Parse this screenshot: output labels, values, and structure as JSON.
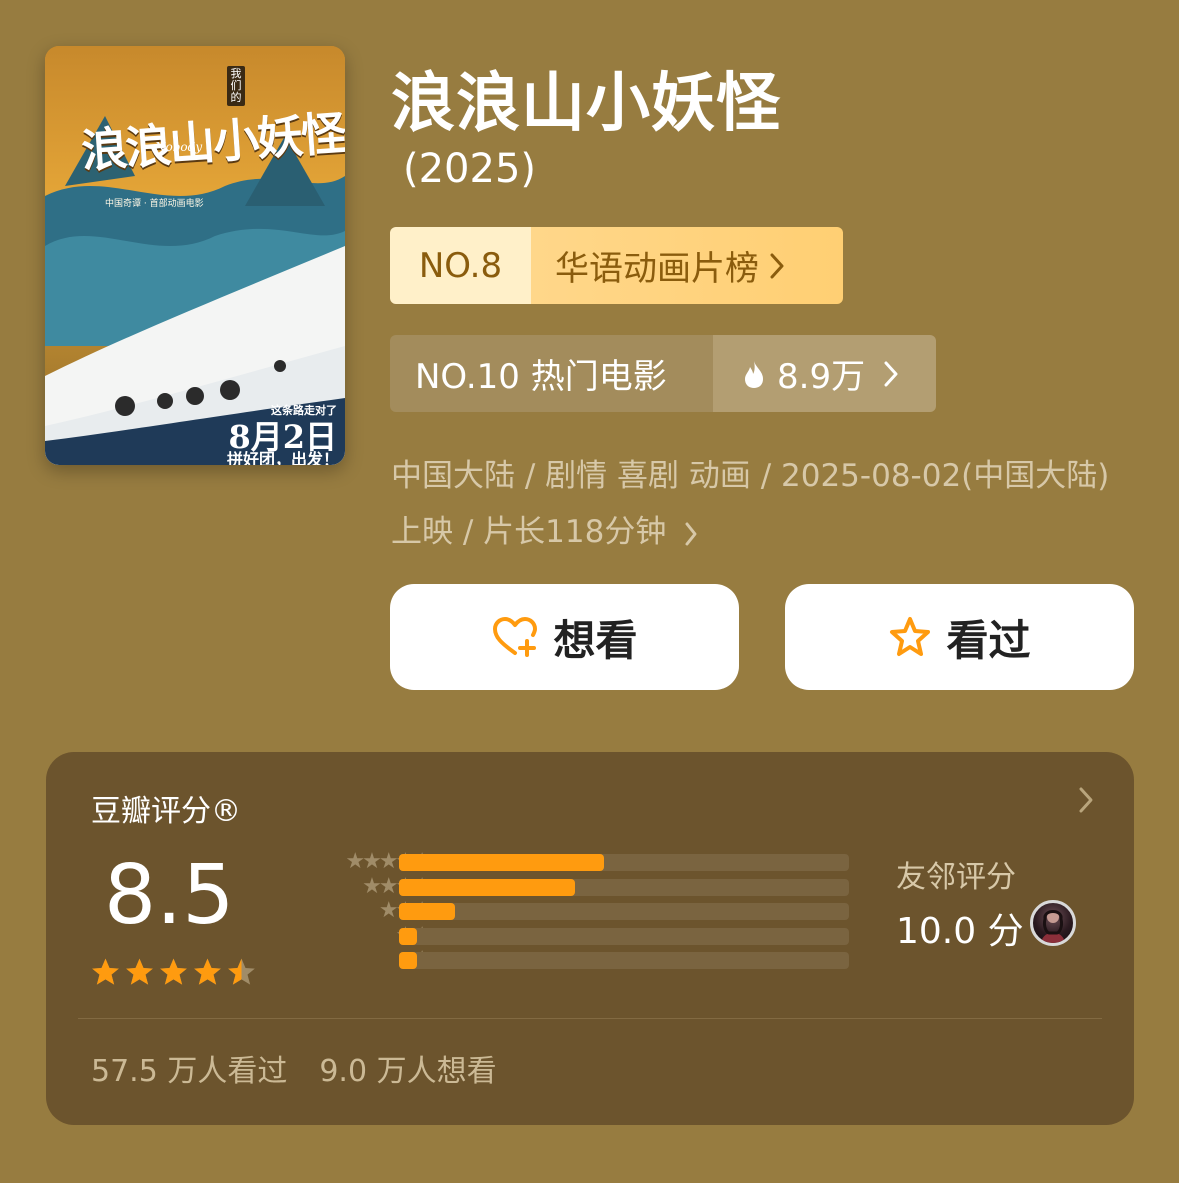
{
  "poster": {
    "title": "浪浪山小妖怪",
    "subtitle": "Nobody",
    "tagline": "中国奇谭 · 首部动画电影",
    "vertical": "我们的",
    "line": "这条路走对了",
    "date": "8月2日",
    "go": "拼好团，出发！"
  },
  "movie": {
    "title": "浪浪山小妖怪",
    "year": "(2025)"
  },
  "rank_list": {
    "no": "NO.8",
    "label": "华语动画片榜"
  },
  "rank_hot": {
    "label": "NO.10 热门电影",
    "heat": "8.9万"
  },
  "meta": {
    "text": "中国大陆 / 剧情 喜剧 动画 / 2025-08-02(中国大陆) 上映 / 片长118分钟"
  },
  "buttons": {
    "want": "想看",
    "seen": "看过"
  },
  "rating": {
    "header": "豆瓣评分®",
    "score": "8.5",
    "star_value": 4.5,
    "distribution": [
      {
        "stars": "★★★★★",
        "fraction": 0.455
      },
      {
        "stars": "★★★★",
        "fraction": 0.39
      },
      {
        "stars": "★★★",
        "fraction": 0.125
      },
      {
        "stars": "★★",
        "fraction": 0.038
      },
      {
        "stars": "★",
        "fraction": 0.038
      }
    ],
    "friends_label": "友邻评分",
    "friends_score": "10.0 分",
    "watched": "57.5 万人看过",
    "wanted": "9.0 万人想看"
  },
  "colors": {
    "background": "#977c40",
    "card": "#6c542d",
    "accent": "#ff9b0f"
  }
}
